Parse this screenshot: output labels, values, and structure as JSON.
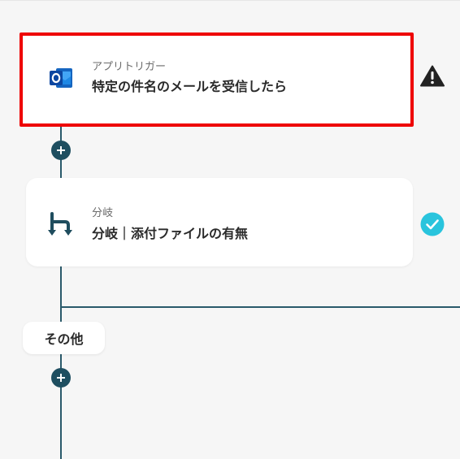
{
  "flow": {
    "trigger": {
      "subtitle": "アプリトリガー",
      "title": "特定の件名のメールを受信したら",
      "icon": "outlook-icon",
      "status_icon": "warning-icon"
    },
    "branch": {
      "subtitle": "分岐",
      "title": "分岐｜添付ファイルの有無",
      "icon": "branch-icon",
      "status_icon": "check-icon"
    },
    "other_branch_label": "その他"
  },
  "colors": {
    "connector": "#2a5a6b",
    "plus_button": "#1e4e60",
    "highlight": "#ee0000",
    "check": "#29c4dd",
    "warning": "#222222"
  }
}
